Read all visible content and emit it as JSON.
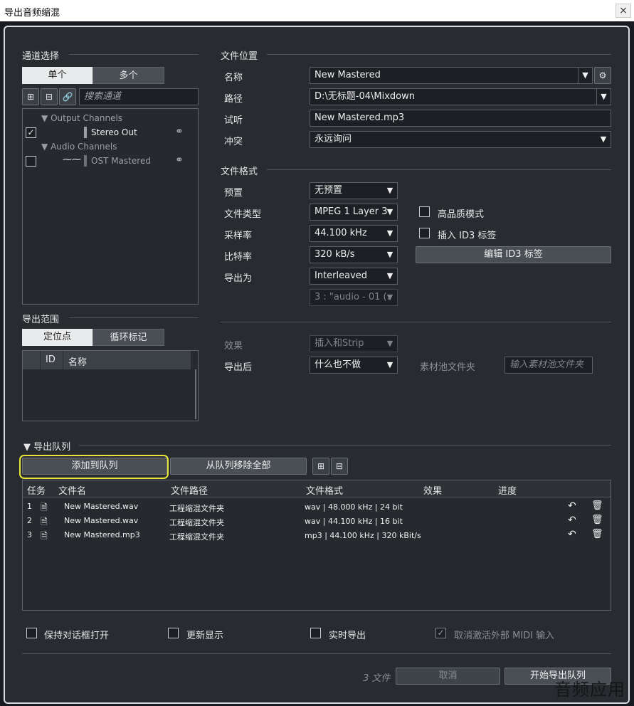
{
  "window": {
    "title": "导出音频缩混",
    "close_glyph": "×"
  },
  "channels": {
    "title": "通道选择",
    "tab_single": "单个",
    "tab_multi": "多个",
    "search_placeholder": "搜索通道",
    "groups": [
      {
        "label": "Output Channels",
        "items": [
          {
            "label": "Stereo Out",
            "checked": true
          }
        ]
      },
      {
        "label": "Audio Channels",
        "items": [
          {
            "label": "OST Mastered",
            "checked": false
          }
        ]
      }
    ]
  },
  "range": {
    "title": "导出范围",
    "tab_locator": "定位点",
    "tab_cycle": "循环标记",
    "col_id": "ID",
    "col_name": "名称"
  },
  "location": {
    "title": "文件位置",
    "name_label": "名称",
    "name_value": "New Mastered",
    "path_label": "路径",
    "path_value": "D:\\无标题-04\\Mixdown",
    "preview_label": "试听",
    "preview_value": "New Mastered.mp3",
    "conflict_label": "冲突",
    "conflict_value": "永远询问"
  },
  "format": {
    "title": "文件格式",
    "preset_label": "预置",
    "preset_value": "无预置",
    "type_label": "文件类型",
    "type_value": "MPEG 1 Layer 3",
    "rate_label": "采样率",
    "rate_value": "44.100 kHz",
    "bitrate_label": "比特率",
    "bitrate_value": "320 kB/s",
    "export_as_label": "导出为",
    "export_as_value": "Interleaved",
    "channel_value": "3 : \"audio - 01 (.",
    "hq_label": "高品质模式",
    "id3_label": "插入 ID3 标签",
    "edit_id3": "编辑 ID3 标签"
  },
  "post": {
    "effects_label": "效果",
    "effects_value": "插入和Strip",
    "after_label": "导出后",
    "after_value": "什么也不做",
    "pool_label": "素材池文件夹",
    "pool_placeholder": "输入素材池文件夹"
  },
  "queue": {
    "title": "导出队列",
    "add_btn": "添加到队列",
    "remove_all_btn": "从队列移除全部",
    "headers": {
      "task": "任务",
      "file": "文件名",
      "path": "文件路径",
      "format": "文件格式",
      "effects": "效果",
      "progress": "进度"
    },
    "rows": [
      {
        "num": "1",
        "file": "New Mastered.wav",
        "path": "工程缩混文件夹",
        "format": "wav | 48.000 kHz | 24 bit"
      },
      {
        "num": "2",
        "file": "New Mastered.wav",
        "path": "工程缩混文件夹",
        "format": "wav | 44.100 kHz | 16 bit"
      },
      {
        "num": "3",
        "file": "New Mastered.mp3",
        "path": "工程缩混文件夹",
        "format": "mp3 | 44.100 kHz | 320  kBit/s"
      }
    ]
  },
  "options": {
    "keep_open": "保持对话框打开",
    "update_display": "更新显示",
    "realtime": "实时导出",
    "deactivate_midi": "取消激活外部 MIDI 输入"
  },
  "footer": {
    "count": "3 文件",
    "cancel": "取消",
    "start": "开始导出队列"
  },
  "watermark": "音频应用",
  "colors": {
    "highlight": "#e8e63a",
    "dialog_bg": "#282c31",
    "field_bg": "#1c1f23"
  }
}
